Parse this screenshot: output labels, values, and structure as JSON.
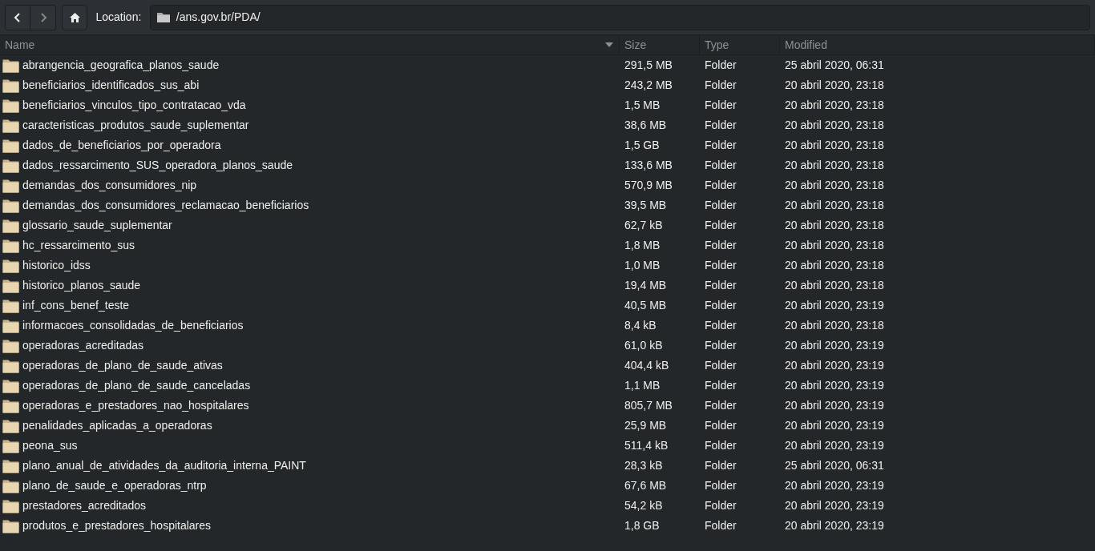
{
  "toolbar": {
    "location_label": "Location:",
    "path": "/ans.gov.br/PDA/"
  },
  "table": {
    "columns": [
      {
        "label": "Name",
        "sorted": true
      },
      {
        "label": "Size",
        "sorted": false
      },
      {
        "label": "Type",
        "sorted": false
      },
      {
        "label": "Modified",
        "sorted": false
      }
    ],
    "rows": [
      {
        "name": "abrangencia_geografica_planos_saude",
        "size": "291,5 MB",
        "type": "Folder",
        "modified": "25 abril 2020, 06:31"
      },
      {
        "name": "beneficiarios_identificados_sus_abi",
        "size": "243,2 MB",
        "type": "Folder",
        "modified": "20 abril 2020, 23:18"
      },
      {
        "name": "beneficiarios_vinculos_tipo_contratacao_vda",
        "size": "1,5 MB",
        "type": "Folder",
        "modified": "20 abril 2020, 23:18"
      },
      {
        "name": "caracteristicas_produtos_saude_suplementar",
        "size": "38,6 MB",
        "type": "Folder",
        "modified": "20 abril 2020, 23:18"
      },
      {
        "name": "dados_de_beneficiarios_por_operadora",
        "size": "1,5 GB",
        "type": "Folder",
        "modified": "20 abril 2020, 23:18"
      },
      {
        "name": "dados_ressarcimento_SUS_operadora_planos_saude",
        "size": "133,6 MB",
        "type": "Folder",
        "modified": "20 abril 2020, 23:18"
      },
      {
        "name": "demandas_dos_consumidores_nip",
        "size": "570,9 MB",
        "type": "Folder",
        "modified": "20 abril 2020, 23:18"
      },
      {
        "name": "demandas_dos_consumidores_reclamacao_beneficiarios",
        "size": "39,5 MB",
        "type": "Folder",
        "modified": "20 abril 2020, 23:18"
      },
      {
        "name": "glossario_saude_suplementar",
        "size": "62,7 kB",
        "type": "Folder",
        "modified": "20 abril 2020, 23:18"
      },
      {
        "name": "hc_ressarcimento_sus",
        "size": "1,8 MB",
        "type": "Folder",
        "modified": "20 abril 2020, 23:18"
      },
      {
        "name": "historico_idss",
        "size": "1,0 MB",
        "type": "Folder",
        "modified": "20 abril 2020, 23:18"
      },
      {
        "name": "historico_planos_saude",
        "size": "19,4 MB",
        "type": "Folder",
        "modified": "20 abril 2020, 23:18"
      },
      {
        "name": "inf_cons_benef_teste",
        "size": "40,5 MB",
        "type": "Folder",
        "modified": "20 abril 2020, 23:19"
      },
      {
        "name": "informacoes_consolidadas_de_beneficiarios",
        "size": "8,4 kB",
        "type": "Folder",
        "modified": "20 abril 2020, 23:18"
      },
      {
        "name": "operadoras_acreditadas",
        "size": "61,0 kB",
        "type": "Folder",
        "modified": "20 abril 2020, 23:19"
      },
      {
        "name": "operadoras_de_plano_de_saude_ativas",
        "size": "404,4 kB",
        "type": "Folder",
        "modified": "20 abril 2020, 23:19"
      },
      {
        "name": "operadoras_de_plano_de_saude_canceladas",
        "size": "1,1 MB",
        "type": "Folder",
        "modified": "20 abril 2020, 23:19"
      },
      {
        "name": "operadoras_e_prestadores_nao_hospitalares",
        "size": "805,7 MB",
        "type": "Folder",
        "modified": "20 abril 2020, 23:19"
      },
      {
        "name": "penalidades_aplicadas_a_operadoras",
        "size": "25,9 MB",
        "type": "Folder",
        "modified": "20 abril 2020, 23:19"
      },
      {
        "name": "peona_sus",
        "size": "511,4 kB",
        "type": "Folder",
        "modified": "20 abril 2020, 23:19"
      },
      {
        "name": "plano_anual_de_atividades_da_auditoria_interna_PAINT",
        "size": "28,3 kB",
        "type": "Folder",
        "modified": "25 abril 2020, 06:31"
      },
      {
        "name": "plano_de_saude_e_operadoras_ntrp",
        "size": "67,6 MB",
        "type": "Folder",
        "modified": "20 abril 2020, 23:19"
      },
      {
        "name": "prestadores_acreditados",
        "size": "54,2 kB",
        "type": "Folder",
        "modified": "20 abril 2020, 23:19"
      },
      {
        "name": "produtos_e_prestadores_hospitalares",
        "size": "1,8 GB",
        "type": "Folder",
        "modified": "20 abril 2020, 23:19"
      }
    ]
  }
}
